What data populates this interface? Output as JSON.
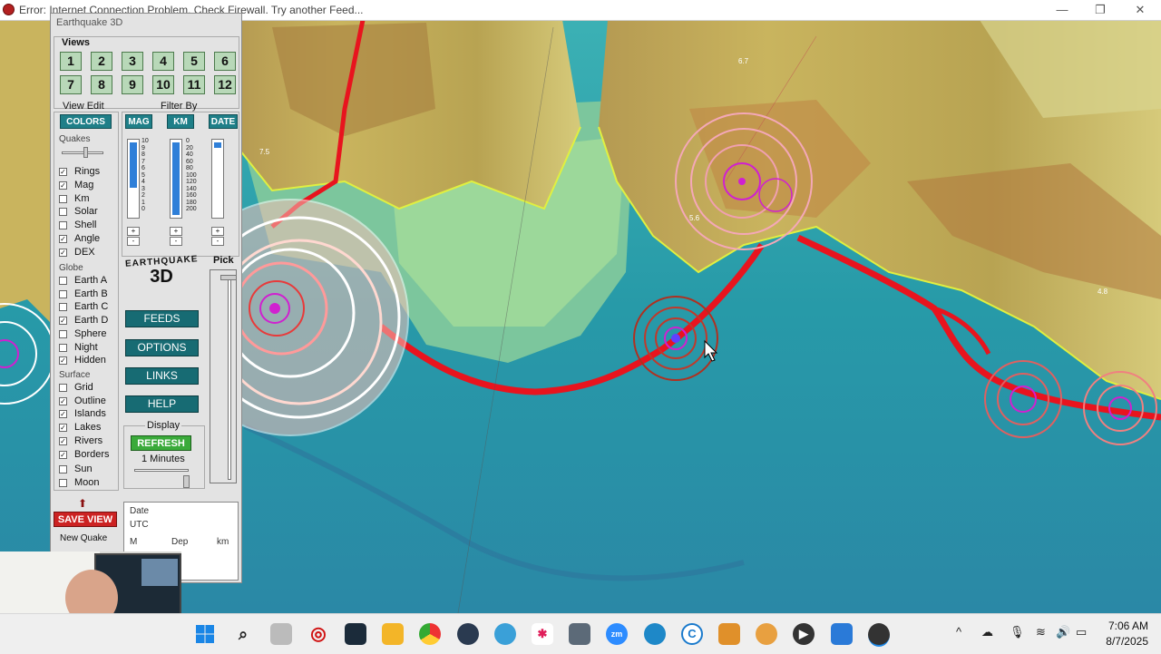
{
  "window": {
    "error_text": "Error: Internet Connection Problem. Check Firewall. Try another Feed...",
    "minimize": "—",
    "maximize": "❐",
    "close": "✕"
  },
  "panel": {
    "title": "Earthquake 3D",
    "views_label": "Views",
    "view_buttons": [
      "1",
      "2",
      "3",
      "4",
      "5",
      "6",
      "7",
      "8",
      "9",
      "10",
      "11",
      "12"
    ],
    "view_edit_label": "View Edit",
    "colors_button": "COLORS",
    "filter_by_label": "Filter By",
    "filter_buttons": [
      "MAG",
      "KM",
      "DATE"
    ],
    "quakes_label": "Quakes",
    "quake_options": [
      {
        "label": "Rings",
        "checked": true
      },
      {
        "label": "Mag",
        "checked": true
      },
      {
        "label": "Km",
        "checked": false
      },
      {
        "label": "Solar",
        "checked": false
      },
      {
        "label": "Shell",
        "checked": false
      },
      {
        "label": "Angle",
        "checked": true
      },
      {
        "label": "DEX",
        "checked": true
      }
    ],
    "globe_label": "Globe",
    "globe_options": [
      {
        "label": "Earth A",
        "checked": false
      },
      {
        "label": "Earth B",
        "checked": false
      },
      {
        "label": "Earth C",
        "checked": false
      },
      {
        "label": "Earth D",
        "checked": true
      },
      {
        "label": "Sphere",
        "checked": false
      },
      {
        "label": "Night",
        "checked": false
      },
      {
        "label": "Hidden",
        "checked": true
      }
    ],
    "surface_label": "Surface",
    "surface_options": [
      {
        "label": "Grid",
        "checked": false
      },
      {
        "label": "Outline",
        "checked": true
      },
      {
        "label": "Islands",
        "checked": true
      },
      {
        "label": "Lakes",
        "checked": true
      },
      {
        "label": "Rivers",
        "checked": true
      },
      {
        "label": "Borders",
        "checked": true
      },
      {
        "label": "Sun",
        "checked": false
      },
      {
        "label": "Moon",
        "checked": false
      }
    ],
    "mag_scale": [
      "10",
      "9",
      "8",
      "7",
      "6",
      "5",
      "4",
      "3",
      "2",
      "1",
      "0"
    ],
    "km_scale": [
      "0",
      "20",
      "40",
      "60",
      "80",
      "100",
      "120",
      "140",
      "160",
      "180",
      "200"
    ],
    "plus": "+",
    "minus": "-",
    "logo_line1": "EARTHQUAKE",
    "logo_line2": "3D",
    "pick_label": "Pick",
    "menu_buttons": [
      "FEEDS",
      "OPTIONS",
      "LINKS",
      "HELP"
    ],
    "display_label": "Display",
    "refresh_button": "REFRESH",
    "refresh_interval": "1 Minutes",
    "save_view_button": "SAVE VIEW",
    "new_quake_label": "New Quake",
    "info": {
      "date_label": "Date",
      "utc_label": "UTC",
      "m_label": "M",
      "dep_label": "Dep",
      "km_label": "km"
    }
  },
  "map_labels": [
    {
      "text": "7.5"
    },
    {
      "text": "6.7"
    },
    {
      "text": "5.6"
    },
    {
      "text": "4.8"
    }
  ],
  "taskbar": {
    "icons": [
      "windows-start",
      "search",
      "target-app",
      "terminal-app",
      "file-explorer",
      "chrome",
      "steam",
      "globe-app",
      "slack",
      "calculator",
      "zoom",
      "vpn-app",
      "c-app",
      "video-app",
      "browser-ball",
      "media-player",
      "photos",
      "earthquake-app"
    ],
    "tray_chevron": "^",
    "time": "7:06 AM",
    "date": "8/7/2025"
  },
  "colors": {
    "accent_teal": "#1f7f88",
    "refresh_green": "#3aaa3a",
    "save_red": "#cc2222",
    "fault_red": "#e8141e",
    "quake_magenta": "#d020d0"
  }
}
